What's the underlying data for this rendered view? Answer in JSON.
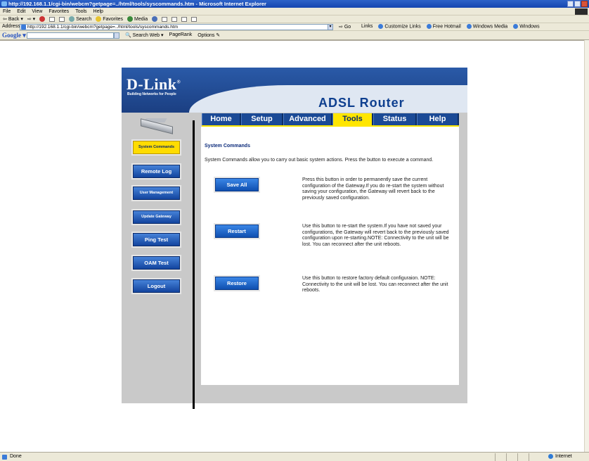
{
  "window": {
    "title": "http://192.168.1.1/cgi-bin/webcm?getpage=../html/tools/syscommands.htm - Microsoft Internet Explorer"
  },
  "menu": [
    "File",
    "Edit",
    "View",
    "Favorites",
    "Tools",
    "Help"
  ],
  "toolbar": {
    "back": "Back",
    "search": "Search",
    "favorites": "Favorites",
    "media": "Media"
  },
  "address": {
    "label": "Address",
    "url": "http://192.168.1.1/cgi-bin/webcm?getpage=../html/tools/syscommands.htm",
    "go": "Go",
    "links_label": "Links",
    "links": [
      "Customize Links",
      "Free Hotmail",
      "Windows Media",
      "Windows"
    ]
  },
  "google": {
    "logo": "Google",
    "search_web": "Search Web",
    "pagerank": "PageRank",
    "options": "Options"
  },
  "router": {
    "brand": "D-Link",
    "brand_mark": "®",
    "tagline": "Building Networks for People",
    "product": "ADSL Router",
    "tabs": [
      "Home",
      "Setup",
      "Advanced",
      "Tools",
      "Status",
      "Help"
    ],
    "active_tab": "Tools",
    "sidebar": [
      {
        "label": "System Commands",
        "active": true
      },
      {
        "label": "Remote Log"
      },
      {
        "label": "User Management"
      },
      {
        "label": "Update Gateway"
      },
      {
        "label": "Ping Test"
      },
      {
        "label": "OAM Test"
      },
      {
        "label": "Logout"
      }
    ],
    "page_title": "System Commands",
    "intro": "System Commands allow you to carry out basic system actions. Press the button to execute a command.",
    "commands": [
      {
        "button": "Save All",
        "desc": "Press this button in order to permanently save the current configuration of the Gateway.If you do re-start the system without saving your configuration, the Gateway will revert back to the previously saved configuration."
      },
      {
        "button": "Restart",
        "desc": "Use this button to re-start the system.If you have not saved your configurations, the Gateway will revert back to the previously saved configuration upon re-starting.NOTE: Connectivity to the unit will be lost. You can reconnect after the unit reboots."
      },
      {
        "button": "Restore",
        "desc": "Use this button to restore factory default configuraion. NOTE: Connectivity to the unit will be lost. You can reconnect after the unit reboots."
      }
    ]
  },
  "status": {
    "text": "Done",
    "zone": "Internet"
  }
}
